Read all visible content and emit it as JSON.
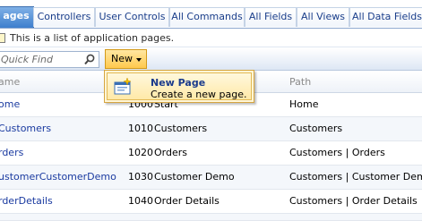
{
  "tabs": [
    {
      "label": "ages",
      "active": true
    },
    {
      "label": "Controllers",
      "active": false
    },
    {
      "label": "User Controls",
      "active": false
    },
    {
      "label": "All Commands",
      "active": false
    },
    {
      "label": "All Fields",
      "active": false
    },
    {
      "label": "All Views",
      "active": false
    },
    {
      "label": "All Data Fields",
      "active": false
    }
  ],
  "description": "This is a list of application pages.",
  "toolbar": {
    "quick_find_placeholder": "Quick Find",
    "new_label": "New"
  },
  "new_menu": {
    "items": [
      {
        "title": "New Page",
        "subtitle": "Create a new page.",
        "icon": "new-page-icon"
      }
    ]
  },
  "grid": {
    "columns": [
      "ame",
      "Path"
    ],
    "rows": [
      {
        "name": "ome",
        "index": "1000",
        "title": "Start",
        "path": "Home"
      },
      {
        "name": "Customers",
        "index": "1010",
        "title": "Customers",
        "path": "Customers"
      },
      {
        "name": "rders",
        "index": "1020",
        "title": "Orders",
        "path": "Customers | Orders"
      },
      {
        "name": "ustomerCustomerDemo",
        "index": "1030",
        "title": "Customer Demo",
        "path": "Customers | Customer Demo"
      },
      {
        "name": "rderDetails",
        "index": "1040",
        "title": "Order Details",
        "path": "Customers | Order Details"
      }
    ]
  },
  "colors": {
    "active_tab": "#3e7fcd",
    "link": "#1a3aa0",
    "menu_bg": "#fff6d7",
    "new_button": "#ffc94d"
  }
}
